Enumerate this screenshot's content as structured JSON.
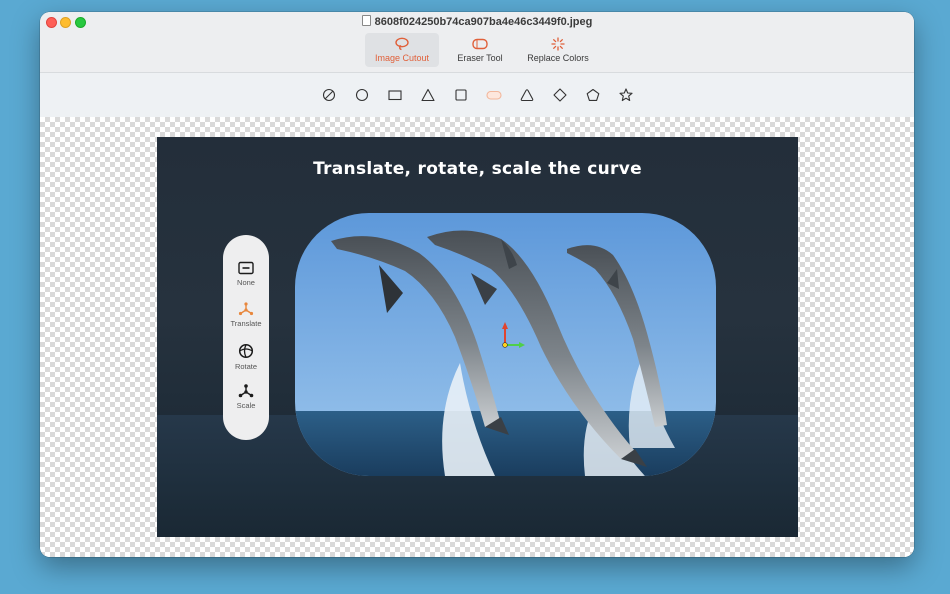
{
  "window": {
    "title": "8608f024250b74ca907ba4e46c3449f0.jpeg"
  },
  "modes": [
    {
      "label": "Image Cutout",
      "icon": "lasso-icon",
      "active": true
    },
    {
      "label": "Eraser Tool",
      "icon": "eraser-icon",
      "active": false
    },
    {
      "label": "Replace Colors",
      "icon": "sparkle-icon",
      "active": false
    }
  ],
  "shapes": [
    {
      "icon": "no-shape-icon"
    },
    {
      "icon": "circle-icon"
    },
    {
      "icon": "rectangle-icon"
    },
    {
      "icon": "triangle-icon"
    },
    {
      "icon": "square-icon"
    },
    {
      "icon": "rounded-rectangle-icon",
      "active": true
    },
    {
      "icon": "rounded-triangle-icon"
    },
    {
      "icon": "diamond-icon"
    },
    {
      "icon": "pentagon-icon"
    },
    {
      "icon": "star-icon"
    }
  ],
  "canvas": {
    "title": "Translate, rotate, scale the curve",
    "tools": [
      {
        "label": "None",
        "icon": "none-tool-icon"
      },
      {
        "label": "Translate",
        "icon": "translate-icon",
        "active": true
      },
      {
        "label": "Rotate",
        "icon": "rotate-icon"
      },
      {
        "label": "Scale",
        "icon": "scale-icon"
      }
    ]
  },
  "colors": {
    "accent": "#e0603a",
    "background": "#5aa9d2"
  }
}
